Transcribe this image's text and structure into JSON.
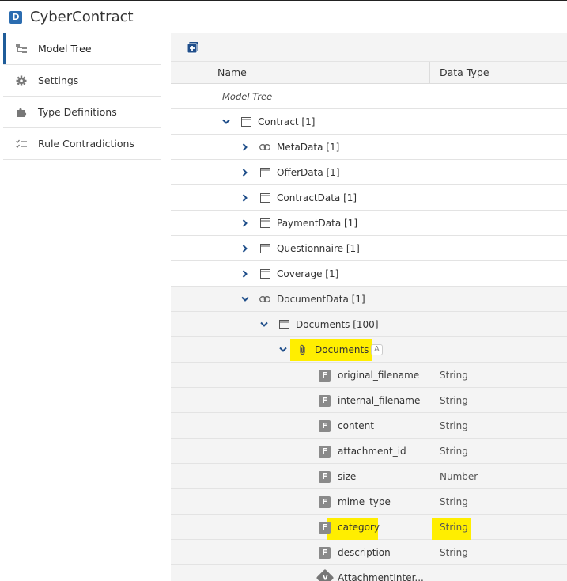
{
  "app": {
    "badge": "D",
    "title": "CyberContract"
  },
  "sidebar": {
    "items": [
      {
        "label": "Model Tree",
        "icon": "tree-icon",
        "active": true
      },
      {
        "label": "Settings",
        "icon": "gear-icon",
        "active": false
      },
      {
        "label": "Type Definitions",
        "icon": "puzzle-icon",
        "active": false
      },
      {
        "label": "Rule Contradictions",
        "icon": "checklist-icon",
        "active": false
      }
    ]
  },
  "table": {
    "headers": {
      "name": "Name",
      "data_type": "Data Type"
    },
    "root_label": "Model Tree",
    "nodes": {
      "contract": "Contract [1]",
      "metadata": "MetaData [1]",
      "offerdata": "OfferData [1]",
      "contractdata": "ContractData [1]",
      "paymentdata": "PaymentData [1]",
      "questionnaire": "Questionnaire [1]",
      "coverage": "Coverage [1]",
      "documentdata": "DocumentData [1]",
      "documents_list": "Documents [100]",
      "documents_attachment": "Documents",
      "attachment_badge": "A"
    },
    "fields": [
      {
        "badge": "F",
        "name": "original_filename",
        "type": "String"
      },
      {
        "badge": "F",
        "name": "internal_filename",
        "type": "String"
      },
      {
        "badge": "F",
        "name": "content",
        "type": "String"
      },
      {
        "badge": "F",
        "name": "attachment_id",
        "type": "String"
      },
      {
        "badge": "F",
        "name": "size",
        "type": "Number"
      },
      {
        "badge": "F",
        "name": "mime_type",
        "type": "String"
      },
      {
        "badge": "F",
        "name": "category",
        "type": "String"
      },
      {
        "badge": "F",
        "name": "description",
        "type": "String"
      }
    ],
    "last_row": {
      "badge": "V",
      "name": "AttachmentInter..."
    }
  },
  "colors": {
    "accent": "#1f5c99",
    "highlight": "#ffee00",
    "badge_gray": "#8a8a8a"
  }
}
